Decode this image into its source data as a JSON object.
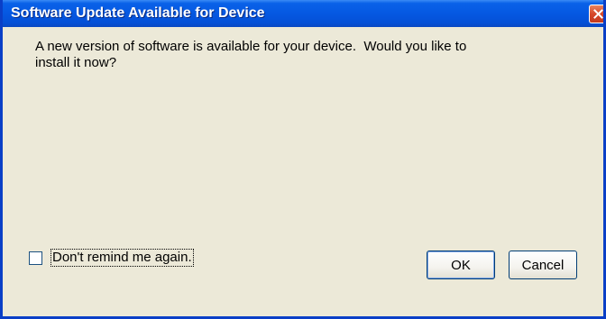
{
  "window": {
    "title": "Software Update Available for Device",
    "close_icon": "close-icon"
  },
  "dialog": {
    "message": "A new version of software is available for your device.  Would you like to\ninstall it now?",
    "checkbox_label": "Don't remind me again.",
    "checkbox_checked": false,
    "ok_label": "OK",
    "cancel_label": "Cancel"
  },
  "colors": {
    "titlebar": "#0558e2",
    "face": "#ece9d8",
    "close": "#d6482a"
  }
}
